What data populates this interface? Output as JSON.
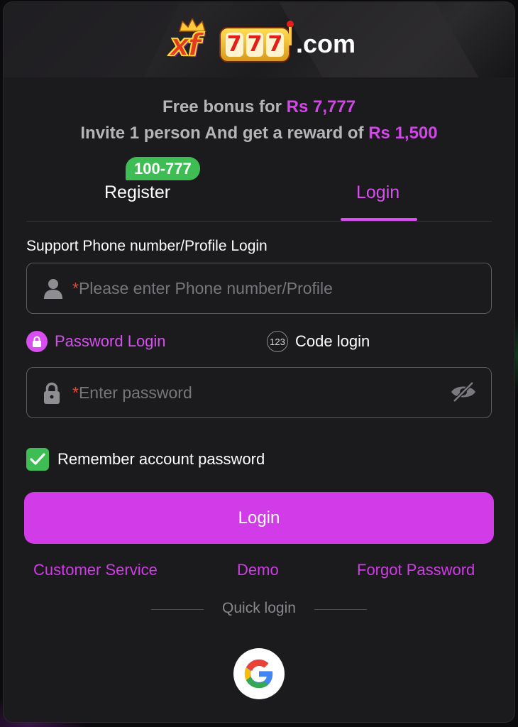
{
  "brand": {
    "logo_text": "xf777",
    "logo_suffix": ".com"
  },
  "promo": {
    "line1_prefix": "Free bonus for ",
    "line1_amount": "Rs 7,777",
    "line2_prefix": "Invite 1 person And get a reward of ",
    "line2_amount": "Rs 1,500"
  },
  "tabs": {
    "register_label": "Register",
    "register_badge": "100-777",
    "login_label": "Login",
    "active": "login"
  },
  "form": {
    "account_label": "Support Phone number/Profile Login",
    "account_placeholder": "Please enter Phone number/Profile",
    "required_mark": "*",
    "password_login_label": "Password Login",
    "code_login_label": "Code login",
    "code_icon_text": "123",
    "password_placeholder": "Enter password",
    "remember_label": "Remember account password",
    "remember_checked": true,
    "submit_label": "Login"
  },
  "links": {
    "customer_service": "Customer Service",
    "demo": "Demo",
    "forgot_password": "Forgot Password"
  },
  "quick_login": {
    "label": "Quick login",
    "providers": [
      "google-icon"
    ]
  },
  "colors": {
    "accent": "#d13be8",
    "badge_green": "#3fbd55",
    "panel": "#1b1b1d"
  }
}
